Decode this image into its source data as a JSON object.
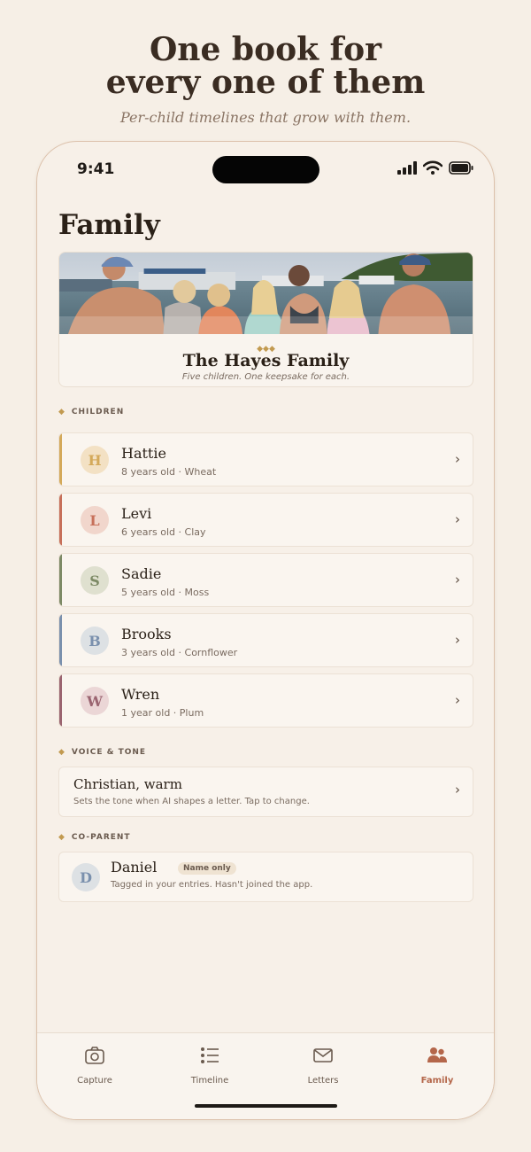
{
  "hero": {
    "title_line1": "One book for",
    "title_line2": "every one of them",
    "subtitle": "Per-child timelines that grow with them."
  },
  "status_bar": {
    "time": "9:41"
  },
  "page_title": "Family",
  "family_card": {
    "name": "The Hayes Family",
    "tagline": "Five children. One keepsake for each.",
    "ornament": "◆◆◆"
  },
  "sections": {
    "children": "CHILDREN",
    "voice": "VOICE & TONE",
    "coparent": "CO-PARENT",
    "marker": "◆"
  },
  "children": [
    {
      "initial": "H",
      "name": "Hattie",
      "meta": "8 years old · Wheat",
      "color": "#d4a95a",
      "tint": "#f3e1c4"
    },
    {
      "initial": "L",
      "name": "Levi",
      "meta": "6 years old · Clay",
      "color": "#c7705a",
      "tint": "#f1d6cc"
    },
    {
      "initial": "S",
      "name": "Sadie",
      "meta": "5 years old · Moss",
      "color": "#7d8a66",
      "tint": "#dfe0cf"
    },
    {
      "initial": "B",
      "name": "Brooks",
      "meta": "3 years old · Cornflower",
      "color": "#7a90ad",
      "tint": "#dde1e4"
    },
    {
      "initial": "W",
      "name": "Wren",
      "meta": "1 year old · Plum",
      "color": "#9a6470",
      "tint": "#ebd6d6"
    }
  ],
  "voice": {
    "name": "Christian, warm",
    "description": "Sets the tone when AI shapes a letter. Tap to change."
  },
  "coparent": {
    "initial": "D",
    "name": "Daniel",
    "badge": "Name only",
    "description": "Tagged in your entries. Hasn't joined the app.",
    "color": "#7a90ad",
    "tint": "#dde1e4"
  },
  "chevron": "›",
  "tabs": [
    {
      "label": "Capture",
      "icon": "camera-icon",
      "active": false
    },
    {
      "label": "Timeline",
      "icon": "list-icon",
      "active": false
    },
    {
      "label": "Letters",
      "icon": "envelope-icon",
      "active": false
    },
    {
      "label": "Family",
      "icon": "people-icon",
      "active": true
    }
  ],
  "colors": {
    "accent": "#b4664a",
    "gold": "#c29a50",
    "background": "#f6efe6"
  }
}
